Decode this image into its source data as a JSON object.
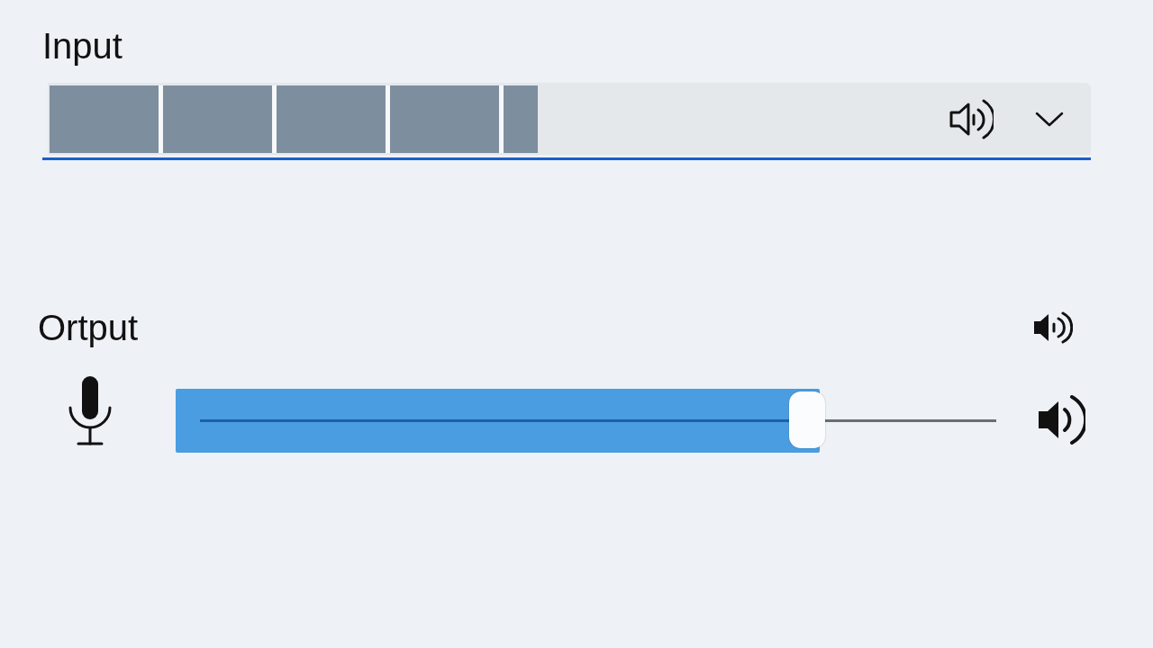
{
  "input": {
    "label": "Input",
    "meter": {
      "level": 0.47
    }
  },
  "output": {
    "label": "Ortput",
    "volume": {
      "level": 0.77
    }
  }
}
